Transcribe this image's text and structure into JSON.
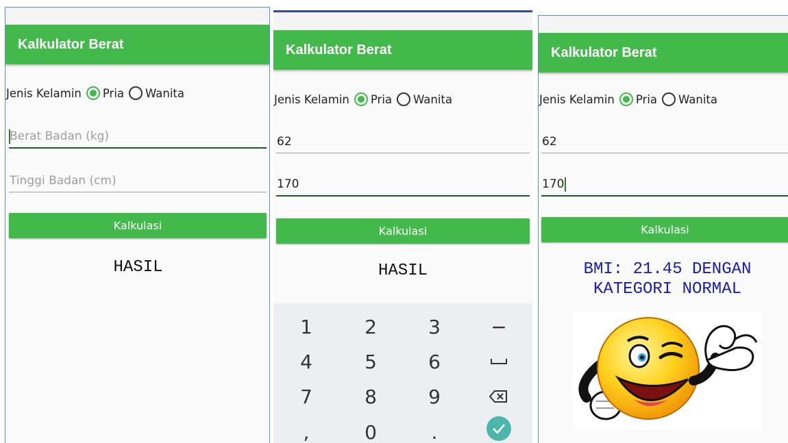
{
  "app": {
    "title": "Kalkulator Berat",
    "accent": "#43b94b"
  },
  "gender": {
    "label": "Jenis Kelamin",
    "options": [
      "Pria",
      "Wanita"
    ],
    "selected": "Pria"
  },
  "screens": [
    {
      "weight": {
        "value": "",
        "placeholder": "Berat Badan (kg)"
      },
      "height": {
        "value": "",
        "placeholder": "Tinggi Badan (cm)"
      },
      "button": "Kalkulasi",
      "result": "HASIL"
    },
    {
      "weight": {
        "value": "62",
        "placeholder": "Berat Badan (kg)"
      },
      "height": {
        "value": "170",
        "placeholder": "Tinggi Badan (cm)"
      },
      "button": "Kalkulasi",
      "result": "HASIL",
      "keypad": {
        "keys": [
          "1",
          "2",
          "3",
          "−",
          "4",
          "5",
          "6",
          "␣",
          "7",
          "8",
          "9",
          "⌫",
          ",",
          "0",
          ".",
          "✓"
        ]
      }
    },
    {
      "weight": {
        "value": "62",
        "placeholder": "Berat Badan (kg)"
      },
      "height": {
        "value": "170",
        "placeholder": "Tinggi Badan (cm)"
      },
      "button": "Kalkulasi",
      "result_line1": "BMI: 21.45 DENGAN",
      "result_line2": "KATEGORI NORMAL",
      "image": "winking-smiley-ok-hand"
    }
  ]
}
